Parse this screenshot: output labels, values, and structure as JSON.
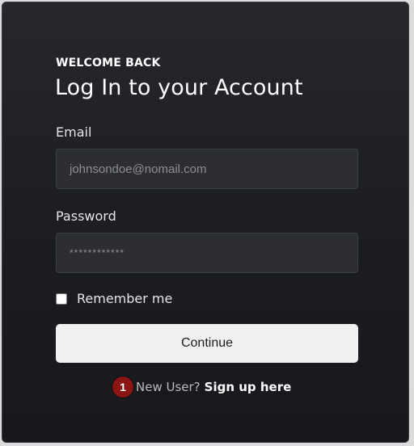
{
  "header": {
    "eyebrow": "WELCOME BACK",
    "title": "Log In to your Account"
  },
  "form": {
    "email_label": "Email",
    "email_placeholder": "johnsondoe@nomail.com",
    "email_value": "",
    "password_label": "Password",
    "password_placeholder": "************",
    "password_value": "",
    "remember_label": "Remember me",
    "remember_checked": false,
    "continue_label": "Continue"
  },
  "footer": {
    "badge": "1",
    "new_user_text": "New User?",
    "signup_label": "Sign up here"
  },
  "colors": {
    "card_background": "#1b1d21",
    "field_background": "#2c2e33",
    "button_background": "#f0f0f0",
    "badge": "#8b1414"
  }
}
